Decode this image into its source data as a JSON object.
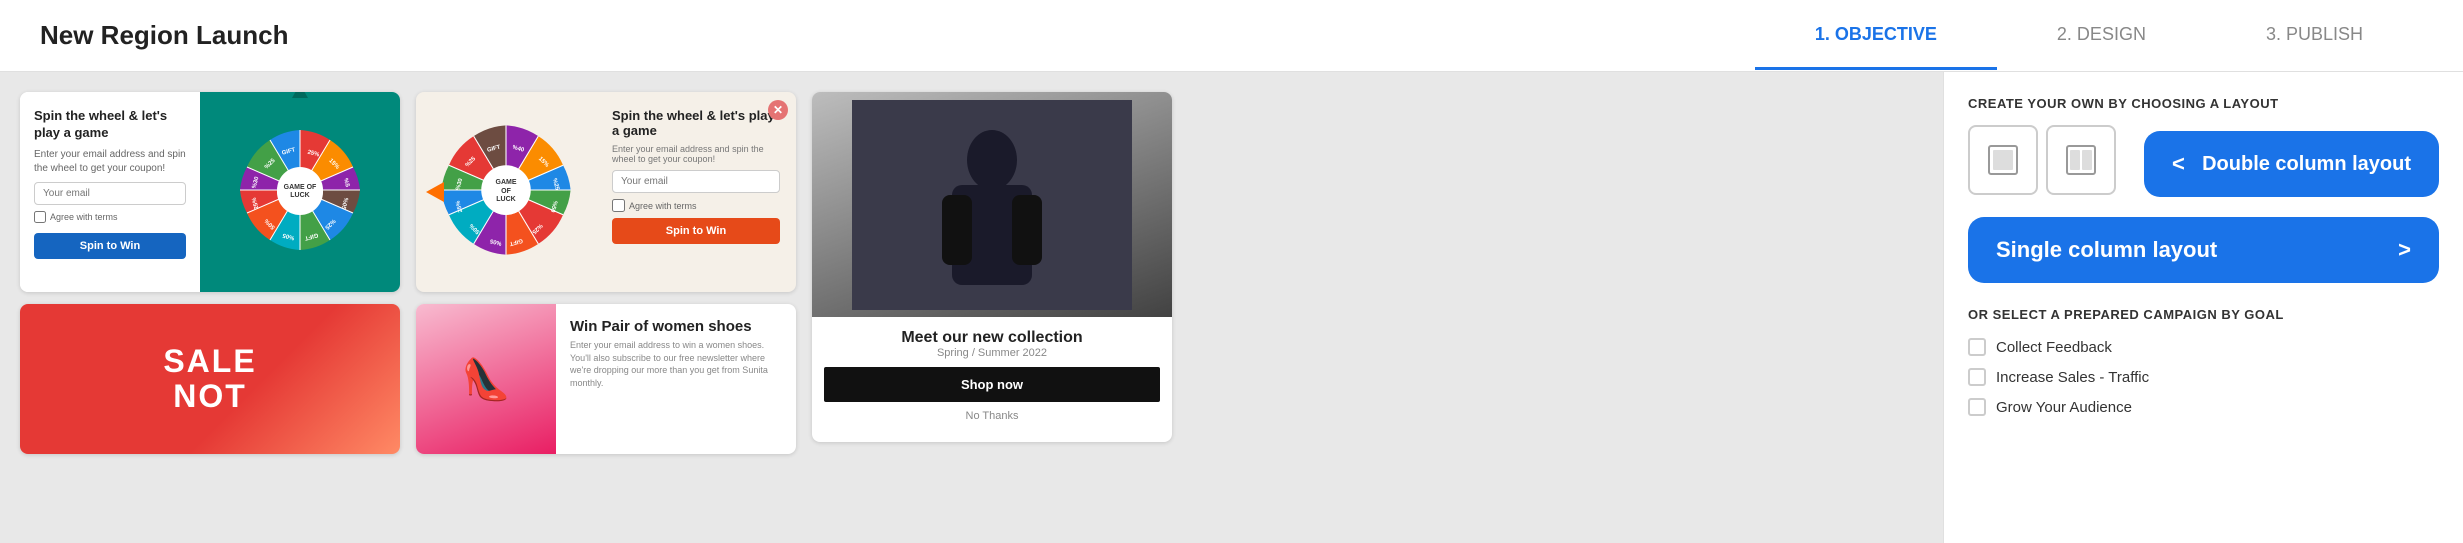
{
  "header": {
    "title": "New Region Launch",
    "tabs": [
      {
        "label": "1. OBJECTIVE",
        "active": true
      },
      {
        "label": "2. DESIGN",
        "active": false
      },
      {
        "label": "3. PUBLISH",
        "active": false
      }
    ]
  },
  "cards": {
    "spin1": {
      "title": "Spin the wheel & let's play a game",
      "description": "Enter your email address and spin the wheel to get your coupon!",
      "email_placeholder": "Your email",
      "terms_label": "Agree with terms",
      "button_label": "Spin to Win",
      "game_label": "GAME OF LUCK"
    },
    "sale": {
      "text1": "SALE",
      "text2": "NOT"
    },
    "spin2": {
      "title": "Spin the wheel & let's play a game",
      "description": "Enter your email address and spin the wheel to get your coupon!",
      "email_placeholder": "Your email",
      "terms_label": "Agree with terms",
      "button_label": "Spin to Win"
    },
    "shoes": {
      "title": "Win Pair of women shoes",
      "description": "Enter your email address to win a women shoes. You'll also subscribe to our free newsletter where we're dropping our more than you get from Sunita monthly."
    },
    "collection": {
      "title": "Meet our new collection",
      "subtitle": "Spring / Summer 2022",
      "shop_button": "Shop now",
      "no_thanks": "No Thanks"
    }
  },
  "right_panel": {
    "create_section_title": "CREATE YOUR OWN BY CHOOSING A LAYOUT",
    "single_col_label": "Single column layout",
    "double_col_label": "Double column layout",
    "single_chevron": ">",
    "double_chevron": "<",
    "or_select_title": "OR SELECT A PREPARED CAMPAIGN BY GOAL",
    "goals": [
      {
        "label": "Collect Feedback"
      },
      {
        "label": "Increase Sales - Traffic"
      },
      {
        "label": "Grow Your Audience"
      }
    ]
  },
  "wheel": {
    "segments": [
      {
        "color": "#e53935",
        "text": "25%"
      },
      {
        "color": "#fb8c00",
        "text": "15%"
      },
      {
        "color": "#8e24aa",
        "text": "%5"
      },
      {
        "color": "#1e88e5",
        "text": "%05"
      },
      {
        "color": "#43a047",
        "text": "%25"
      },
      {
        "color": "#00acc1",
        "text": "GIFT"
      },
      {
        "color": "#f4511e",
        "text": "%05"
      },
      {
        "color": "#6d4c41",
        "text": "50%"
      },
      {
        "color": "#e53935",
        "text": "25%"
      },
      {
        "color": "#8e24aa",
        "text": "%30"
      },
      {
        "color": "#43a047",
        "text": "%25"
      },
      {
        "color": "#1e88e5",
        "text": "GIFT"
      }
    ]
  }
}
